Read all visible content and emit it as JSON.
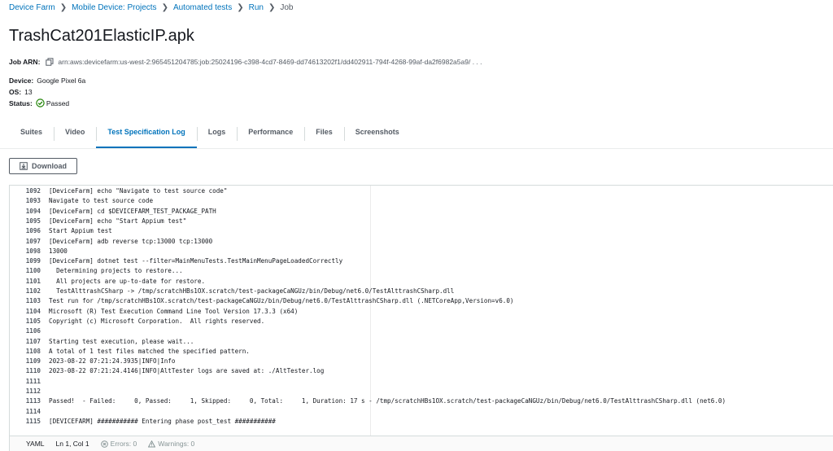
{
  "breadcrumb": {
    "items": [
      "Device Farm",
      "Mobile Device: Projects",
      "Automated tests",
      "Run"
    ],
    "current": "Job"
  },
  "page": {
    "title": "TrashCat201ElasticIP.apk"
  },
  "job": {
    "arn_label": "Job ARN:",
    "arn_value": "arn:aws:devicefarm:us-west-2:965451204785:job:25024196-c398-4cd7-8469-dd74613202f1/dd402911-794f-4268-99af-da2f6982a5a9/ . . .",
    "device_label": "Device:",
    "device_value": "Google Pixel 6a",
    "os_label": "OS:",
    "os_value": "13",
    "status_label": "Status:",
    "status_value": "Passed"
  },
  "tabs": [
    "Suites",
    "Video",
    "Test Specification Log",
    "Logs",
    "Performance",
    "Files",
    "Screenshots"
  ],
  "active_tab": "Test Specification Log",
  "toolbar": {
    "download_label": "Download"
  },
  "log_lines": [
    {
      "n": "1092",
      "text": "[DeviceFarm] echo \"Navigate to test source code\""
    },
    {
      "n": "1093",
      "text": "Navigate to test source code"
    },
    {
      "n": "1094",
      "text": "[DeviceFarm] cd $DEVICEFARM_TEST_PACKAGE_PATH"
    },
    {
      "n": "1095",
      "text": "[DeviceFarm] echo \"Start Appium test\""
    },
    {
      "n": "1096",
      "text": "Start Appium test"
    },
    {
      "n": "1097",
      "text": "[DeviceFarm] adb reverse tcp:13000 tcp:13000"
    },
    {
      "n": "1098",
      "text": "13000"
    },
    {
      "n": "1099",
      "text": "[DeviceFarm] dotnet test --filter=MainMenuTests.TestMainMenuPageLoadedCorrectly"
    },
    {
      "n": "1100",
      "text": "  Determining projects to restore..."
    },
    {
      "n": "1101",
      "text": "  All projects are up-to-date for restore."
    },
    {
      "n": "1102",
      "text": "  TestAlttrashCSharp -> /tmp/scratchHBs1OX.scratch/test-packageCaNGUz/bin/Debug/net6.0/TestAlttrashCSharp.dll"
    },
    {
      "n": "1103",
      "text": "Test run for /tmp/scratchHBs1OX.scratch/test-packageCaNGUz/bin/Debug/net6.0/TestAlttrashCSharp.dll (.NETCoreApp,Version=v6.0)"
    },
    {
      "n": "1104",
      "text": "Microsoft (R) Test Execution Command Line Tool Version 17.3.3 (x64)"
    },
    {
      "n": "1105",
      "text": "Copyright (c) Microsoft Corporation.  All rights reserved."
    },
    {
      "n": "1106",
      "text": ""
    },
    {
      "n": "1107",
      "text": "Starting test execution, please wait..."
    },
    {
      "n": "1108",
      "text": "A total of 1 test files matched the specified pattern."
    },
    {
      "n": "1109",
      "text": "2023-08-22 07:21:24.3935|INFO|Info"
    },
    {
      "n": "1110",
      "text": "2023-08-22 07:21:24.4146|INFO|AltTester logs are saved at: ./AltTester.log"
    },
    {
      "n": "1111",
      "text": ""
    },
    {
      "n": "1112",
      "text": ""
    },
    {
      "n": "1113",
      "text": "Passed!  - Failed:     0, Passed:     1, Skipped:     0, Total:     1, Duration: 17 s - /tmp/scratchHBs1OX.scratch/test-packageCaNGUz/bin/Debug/net6.0/TestAlttrashCSharp.dll (net6.0)"
    },
    {
      "n": "1114",
      "text": ""
    },
    {
      "n": "1115",
      "text": "[DEVICEFARM] ########### Entering phase post_test ###########"
    }
  ],
  "status_bar": {
    "language": "YAML",
    "position": "Ln 1, Col 1",
    "errors": "Errors: 0",
    "warnings": "Warnings: 0"
  },
  "colors": {
    "link": "#0073bb",
    "success": "#1d8102",
    "text": "#16191f",
    "muted": "#545b64"
  }
}
